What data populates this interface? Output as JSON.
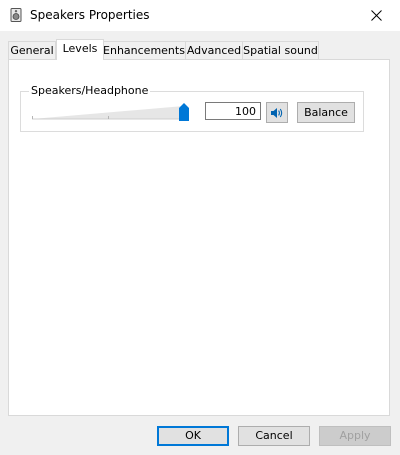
{
  "window": {
    "title": "Speakers Properties",
    "icon": "speaker-icon",
    "close_icon": "close-icon"
  },
  "tabs": [
    {
      "label": "General",
      "active": false
    },
    {
      "label": "Levels",
      "active": true
    },
    {
      "label": "Enhancements",
      "active": false
    },
    {
      "label": "Advanced",
      "active": false
    },
    {
      "label": "Spatial sound",
      "active": false
    }
  ],
  "levels": {
    "group_label": "Speakers/Headphone",
    "volume_value": "100",
    "volume_fraction": 1.0,
    "mute_icon": "speaker-volume-icon",
    "balance_label": "Balance"
  },
  "footer": {
    "ok_label": "OK",
    "cancel_label": "Cancel",
    "apply_label": "Apply"
  },
  "colors": {
    "accent": "#0078d7",
    "window_bg": "#f0f0f0",
    "panel_bg": "#ffffff"
  }
}
